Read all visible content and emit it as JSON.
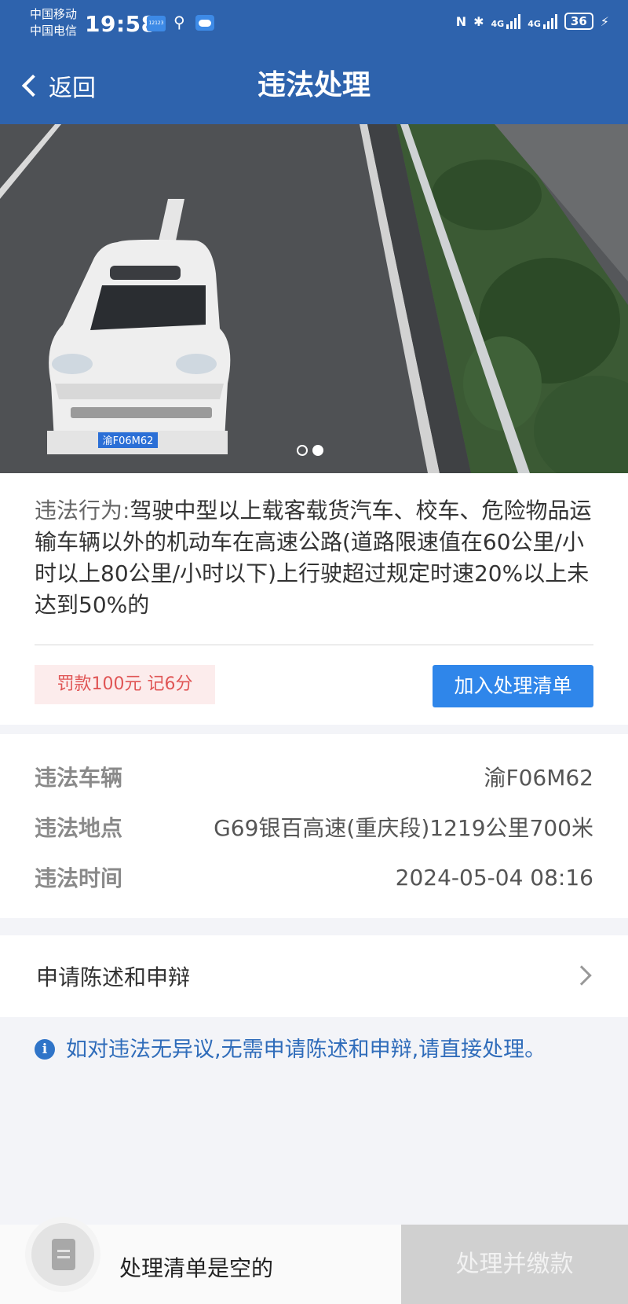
{
  "status_bar": {
    "carrier_1": "中国移动",
    "carrier_2": "中国电信",
    "time": "19:58",
    "network": "4G",
    "battery": "36"
  },
  "header": {
    "back_label": "返回",
    "title": "违法处理"
  },
  "photo": {
    "plate_text": "渝F06M62",
    "carousel_total": 2,
    "carousel_active": 2
  },
  "violation": {
    "behavior_label": "违法行为:",
    "behavior_text": "驾驶中型以上载客载货汽车、校车、危险物品运输车辆以外的机动车在高速公路(道路限速值在60公里/小时以上80公里/小时以下)上行驶超过规定时速20%以上未达到50%的",
    "penalty": "罚款100元 记6分",
    "add_button": "加入处理清单"
  },
  "details": [
    {
      "key": "违法车辆",
      "value": "渝F06M62"
    },
    {
      "key": "违法地点",
      "value": "G69银百高速(重庆段)1219公里700米"
    },
    {
      "key": "违法时间",
      "value": "2024-05-04 08:16"
    }
  ],
  "appeal": {
    "label": "申请陈述和申辩"
  },
  "notice": {
    "icon": "i",
    "text": "如对违法无异议,无需申请陈述和申辩,请直接处理。"
  },
  "bottom_bar": {
    "cart_status": "处理清单是空的",
    "pay_button": "处理并缴款"
  },
  "colors": {
    "header_bg": "#2e63ad",
    "primary_button": "#2f86ea",
    "penalty_text": "#e05555",
    "penalty_bg": "#fcecec",
    "notice_text": "#2f6cba",
    "disabled_button": "#d0d0d0"
  }
}
